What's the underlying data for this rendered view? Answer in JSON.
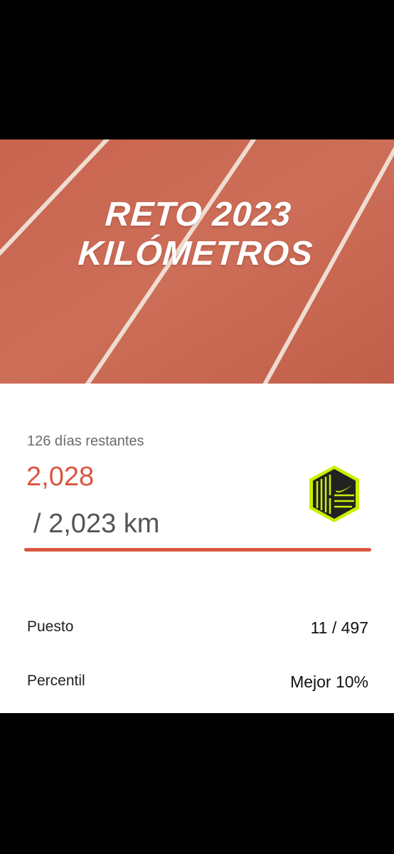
{
  "hero": {
    "title_line1": "RETO 2023",
    "title_line2": "KILÓMETROS"
  },
  "challenge": {
    "days_left": "126 días restantes",
    "current": "2,028",
    "goal": "/ 2,023 km",
    "progress_fraction": 1.0
  },
  "stats": {
    "rank_label": "Puesto",
    "rank_value": "11 / 497",
    "percentile_label": "Percentil",
    "percentile_value": "Mejor 10%"
  },
  "colors": {
    "accent": "#d9563f",
    "track": "#c96a55",
    "badge_green": "#c8f000",
    "badge_dark": "#222222"
  },
  "icons": {
    "badge": "nike-challenge-badge-icon"
  }
}
